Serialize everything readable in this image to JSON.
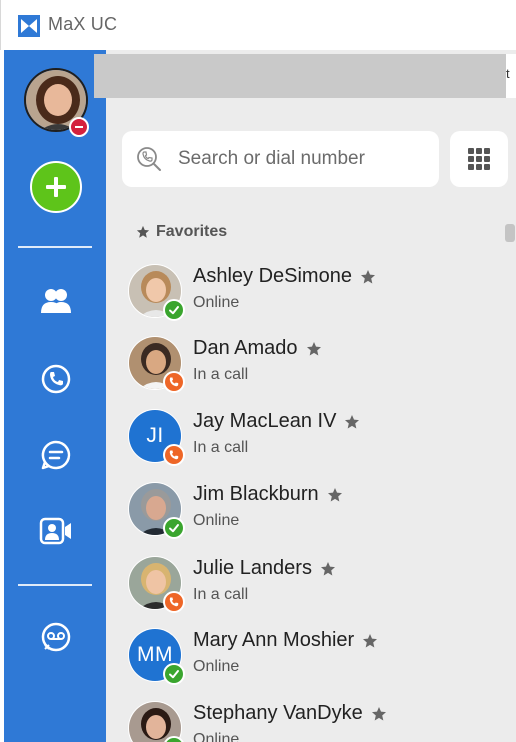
{
  "app": {
    "title": "MaX UC"
  },
  "rail": {
    "icons": [
      "contacts-icon",
      "phone-icon",
      "chat-icon",
      "video-meeting-icon",
      "voicemail-icon"
    ]
  },
  "banner": {
    "edge_text": "t"
  },
  "search": {
    "placeholder": "Search or dial number"
  },
  "favorites": {
    "header": "Favorites",
    "contacts": [
      {
        "name": "Ashley DeSimone",
        "status": "Online",
        "state": "online",
        "photo": true,
        "initials": ""
      },
      {
        "name": "Dan Amado",
        "status": "In a call",
        "state": "call",
        "photo": true,
        "initials": ""
      },
      {
        "name": "Jay MacLean IV",
        "status": "In a call",
        "state": "call",
        "photo": false,
        "initials": "JI"
      },
      {
        "name": "Jim Blackburn",
        "status": "Online",
        "state": "online",
        "photo": true,
        "initials": ""
      },
      {
        "name": "Julie Landers",
        "status": "In a call",
        "state": "call",
        "photo": true,
        "initials": ""
      },
      {
        "name": "Mary Ann Moshier",
        "status": "Online",
        "state": "online",
        "photo": false,
        "initials": "MM"
      },
      {
        "name": "Stephany VanDyke",
        "status": "Online",
        "state": "online",
        "photo": true,
        "initials": ""
      }
    ]
  },
  "colors": {
    "rail": "#2f79d6",
    "new_button": "#5ec41a",
    "online": "#3aa52e",
    "in_call": "#ee6627",
    "dnd": "#d4213d",
    "initials_bg": "#1f73d2"
  }
}
